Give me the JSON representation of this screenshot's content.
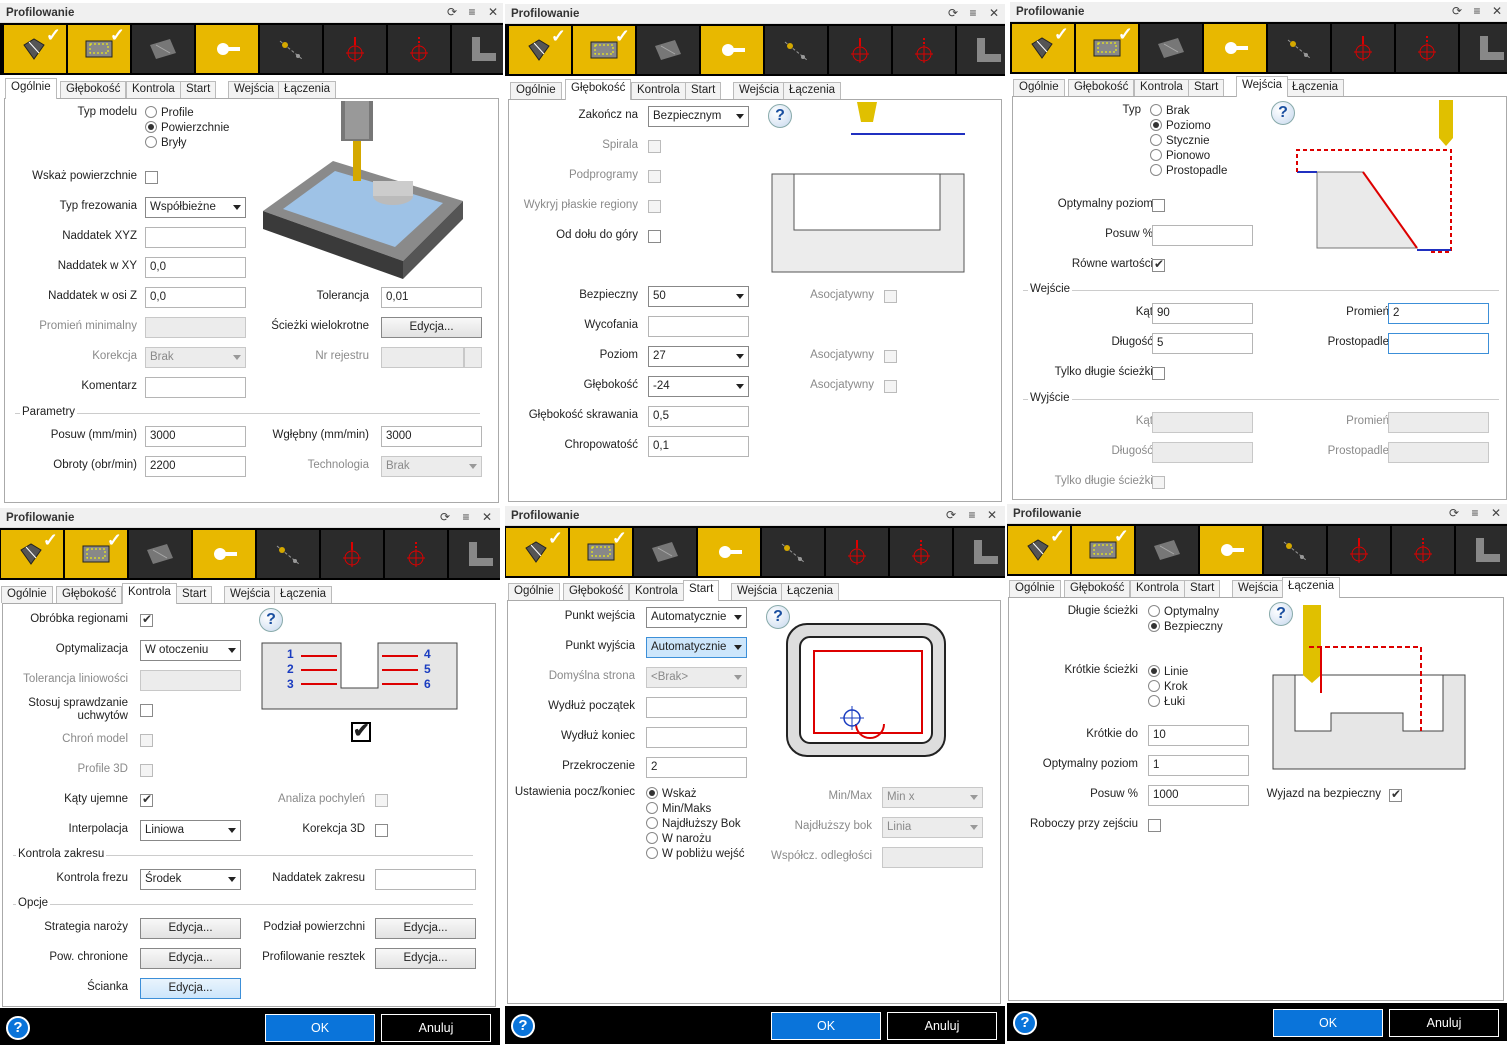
{
  "common": {
    "title": "Profilowanie",
    "tabs": [
      "Ogólnie",
      "Głębokość",
      "Kontrola",
      "Start",
      "Wejścia",
      "Łączenia"
    ],
    "ok": "OK",
    "cancel": "Anuluj",
    "help": "?"
  },
  "p1": {
    "typ_modelu": "Typ modelu",
    "r_profile": "Profile",
    "r_pow": "Powierzchnie",
    "r_bryly": "Bryły",
    "wskaz": "Wskaż powierzchnie",
    "typ_frez": "Typ frezowania",
    "typ_frez_val": "Współbieżne",
    "nad_xyz": "Naddatek XYZ",
    "nad_xy": "Naddatek w XY",
    "nad_xy_val": "0,0",
    "nad_z": "Naddatek w osi Z",
    "nad_z_val": "0,0",
    "tolerancja": "Tolerancja",
    "tolerancja_val": "0,01",
    "promien_min": "Promień minimalny",
    "sciezki_wiel": "Ścieżki wielokrotne",
    "edycja": "Edycja...",
    "korekcja": "Korekcja",
    "korekcja_val": "Brak",
    "nr_rejestru": "Nr rejestru",
    "komentarz": "Komentarz",
    "parametry": "Parametry",
    "posuw": "Posuw (mm/min)",
    "posuw_val": "3000",
    "wglebny": "Wgłębny (mm/min)",
    "wglebny_val": "3000",
    "obroty": "Obroty (obr/min)",
    "obroty_val": "2200",
    "technologia": "Technologia",
    "technologia_val": "Brak"
  },
  "p2": {
    "zakoncz": "Zakończ na",
    "zakoncz_val": "Bezpiecznym",
    "spirala": "Spirala",
    "podprogramy": "Podprogramy",
    "wykryj": "Wykryj płaskie regiony",
    "od_dolu": "Od dołu do góry",
    "bezpieczny": "Bezpieczny",
    "bezpieczny_val": "50",
    "wycofania": "Wycofania",
    "poziom": "Poziom",
    "poziom_val": "27",
    "glebokosc": "Głębokość",
    "glebokosc_val": "-24",
    "gl_skraw": "Głębokość skrawania",
    "gl_skraw_val": "0,5",
    "chropowatosc": "Chropowatość",
    "chropowatosc_val": "0,1",
    "asocjatywny": "Asocjatywny"
  },
  "p3": {
    "typ": "Typ",
    "r_brak": "Brak",
    "r_poziomo": "Poziomo",
    "r_stycznie": "Stycznie",
    "r_pionowo": "Pionowo",
    "r_prostopadle": "Prostopadle",
    "opt_poziom": "Optymalny poziom",
    "posuw_pct": "Posuw %",
    "rowne": "Równe wartości",
    "wejscie": "Wejście",
    "kat": "Kąt",
    "kat_val": "90",
    "promien": "Promień",
    "promien_val": "2",
    "dlugosc": "Długość",
    "dlugosc_val": "5",
    "prostopadle": "Prostopadle",
    "tylko_dlugie": "Tylko długie ścieżki",
    "wyjscie": "Wyjście"
  },
  "p4": {
    "obrobka": "Obróbka regionami",
    "optymalizacja": "Optymalizacja",
    "optymalizacja_val": "W otoczeniu",
    "tol_lin": "Tolerancja liniowości",
    "stosuj1": "Stosuj sprawdzanie",
    "stosuj2": "uchwytów",
    "chron": "Chroń model",
    "profile3d": "Profile 3D",
    "katy": "Kąty ujemne",
    "analiza": "Analiza pochyleń",
    "interpolacja": "Interpolacja",
    "interpolacja_val": "Liniowa",
    "korekcja3d": "Korekcja 3D",
    "kontrola_zakresu": "Kontrola zakresu",
    "kontrola_frezu": "Kontrola frezu",
    "kontrola_frezu_val": "Środek",
    "nad_zakresu": "Naddatek zakresu",
    "opcje": "Opcje",
    "strategia": "Strategia naroży",
    "podzial": "Podział powierzchni",
    "pow_chron": "Pow. chronione",
    "prof_resztek": "Profilowanie resztek",
    "scianka": "Ścianka",
    "edycja": "Edycja...",
    "nums_left": [
      "1",
      "2",
      "3"
    ],
    "nums_right": [
      "4",
      "5",
      "6"
    ]
  },
  "p5": {
    "punkt_wej": "Punkt wejścia",
    "punkt_wej_val": "Automatycznie",
    "punkt_wyj": "Punkt wyjścia",
    "punkt_wyj_val": "Automatycznie",
    "dom_strona": "Domyślna strona",
    "dom_strona_val": "<Brak>",
    "wydluz_p": "Wydłuż początek",
    "wydluz_k": "Wydłuż koniec",
    "przekroczenie": "Przekroczenie",
    "przekroczenie_val": "2",
    "ustawienia": "Ustawienia pocz/koniec",
    "r_wskaz": "Wskaż",
    "r_minmaks": "Min/Maks",
    "r_najdl": "Najdłuższy Bok",
    "r_narozu": "W narożu",
    "r_poblizu": "W pobliżu wejść",
    "minmax": "Min/Max",
    "minmax_val": "Min x",
    "najdl_bok": "Najdłuższy bok",
    "najdl_bok_val": "Linia",
    "wspolcz": "Współcz. odległości"
  },
  "p6": {
    "dlugie": "Długie ścieżki",
    "r_optymalny": "Optymalny",
    "r_bezpieczny": "Bezpieczny",
    "krotkie": "Krótkie ścieżki",
    "r_linie": "Linie",
    "r_krok": "Krok",
    "r_luki": "Łuki",
    "krotkie_do": "Krótkie do",
    "krotkie_do_val": "10",
    "opt_poziom": "Optymalny poziom",
    "opt_poziom_val": "1",
    "posuw": "Posuw %",
    "posuw_val": "1000",
    "wyjazd": "Wyjazd na bezpieczny",
    "roboczy": "Roboczy przy zejściu"
  }
}
